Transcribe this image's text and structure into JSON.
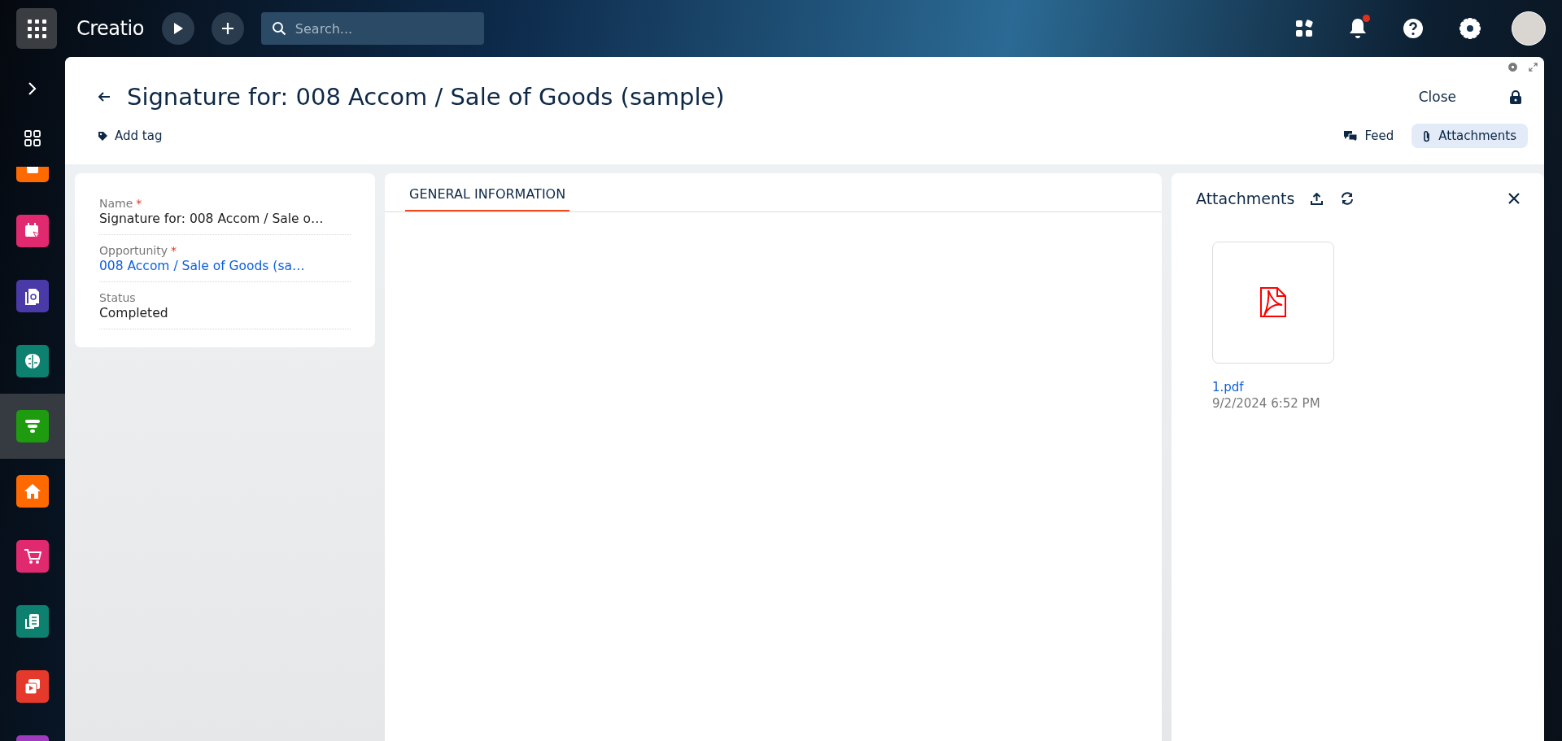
{
  "top_bar": {
    "logo": "Creatio",
    "search": {
      "placeholder": "Search..."
    },
    "notification_badge": true
  },
  "sidebar": {
    "items": [
      {
        "kind": "box",
        "color": "#ff6a00",
        "selected": false
      },
      {
        "kind": "calendar",
        "color": "#e0296f",
        "selected": false
      },
      {
        "kind": "document",
        "color": "#4a3aa8",
        "selected": false
      },
      {
        "kind": "brain",
        "color": "#0d8070",
        "selected": false
      },
      {
        "kind": "funnel",
        "color": "#1e9b0e",
        "selected": true
      },
      {
        "kind": "home",
        "color": "#ff6a00",
        "selected": false
      },
      {
        "kind": "cart",
        "color": "#e0296f",
        "selected": false
      },
      {
        "kind": "form",
        "color": "#0d8070",
        "selected": false
      },
      {
        "kind": "media",
        "color": "#e5392b",
        "selected": false
      },
      {
        "kind": "box",
        "color": "#a03bbf",
        "selected": false
      }
    ]
  },
  "page": {
    "title": "Signature for: 008 Accom / Sale of Goods (sample)",
    "close": "Close",
    "add_tag": "Add tag",
    "actions": [
      {
        "label": "Feed",
        "kind": "feed",
        "selected": false
      },
      {
        "label": "Attachments",
        "kind": "clip",
        "selected": true
      }
    ]
  },
  "fields": [
    {
      "label": "Name",
      "required_mark": "*",
      "value": "Signature for: 008 Accom / Sale o…",
      "link": false
    },
    {
      "label": "Opportunity",
      "required_mark": "*",
      "value": "008 Accom / Sale of Goods (sa…",
      "link": true
    },
    {
      "label": "Status",
      "value": "Completed",
      "link": false
    }
  ],
  "tabs": [
    {
      "label": "GENERAL INFORMATION",
      "selected": true
    }
  ],
  "attachments": {
    "title": "Attachments",
    "files": [
      {
        "name": "1.pdf",
        "date": "9/2/2024 6:52 PM"
      }
    ]
  }
}
